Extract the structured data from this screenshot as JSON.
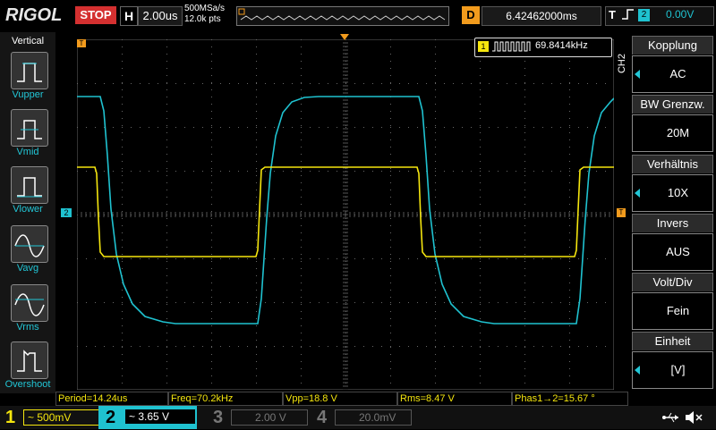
{
  "topbar": {
    "logo": "RIGOL",
    "run_state": "STOP",
    "horizontal_icon": "H",
    "timebase": "2.00us",
    "sample_rate": "500MSa/s",
    "memory_depth": "12.0k pts",
    "delay_icon": "D",
    "delay_value": "6.42462000ms",
    "trigger_icon": "T",
    "trigger_edge_icon": "rising-edge-icon",
    "trigger_source": "2",
    "trigger_level": "0.00V"
  },
  "left_panel": {
    "title": "Vertical",
    "items": [
      {
        "label": "Vupper",
        "icon": "vupper-icon"
      },
      {
        "label": "Vmid",
        "icon": "vmid-icon"
      },
      {
        "label": "Vlower",
        "icon": "vlower-icon"
      },
      {
        "label": "Vavg",
        "icon": "vavg-icon"
      },
      {
        "label": "Vrms",
        "icon": "vrms-icon"
      },
      {
        "label": "Overshoot",
        "icon": "overshoot-icon"
      }
    ]
  },
  "frequency_counter": {
    "channel": "1",
    "value": "69.8414kHz"
  },
  "markers": {
    "ch1_level": "1",
    "ch2_level": "2",
    "trigger_position": "T"
  },
  "right_menu": {
    "channel_label": "CH2",
    "items": [
      {
        "title": "Kopplung",
        "value": "AC"
      },
      {
        "title": "BW Grenzw.",
        "value": "20M"
      },
      {
        "title": "Verhältnis",
        "value": "10X"
      },
      {
        "title": "Invers",
        "value": "AUS"
      },
      {
        "title": "Volt/Div",
        "value": "Fein"
      },
      {
        "title": "Einheit",
        "value": "[V]"
      }
    ]
  },
  "measurements": [
    {
      "text": "Period=14.24us"
    },
    {
      "text": "Freq=70.2kHz"
    },
    {
      "text": "Vpp=18.8 V"
    },
    {
      "text": "Rms=8.47 V"
    },
    {
      "text": "Phas1→2=15.67 °"
    }
  ],
  "channels": [
    {
      "num": "1",
      "coupling": "~",
      "scale": "500mV",
      "active": true,
      "color": "#f5e60e"
    },
    {
      "num": "2",
      "coupling": "~",
      "scale": "3.65 V",
      "active": true,
      "color": "#1fc2d0"
    },
    {
      "num": "3",
      "coupling": "",
      "scale": "2.00 V",
      "active": false,
      "color": "#777777"
    },
    {
      "num": "4",
      "coupling": "",
      "scale": "20.0mV",
      "active": false,
      "color": "#777777"
    }
  ],
  "colors": {
    "ch1": "#f5e60e",
    "ch2": "#1fc2d0",
    "trigger": "#f29b1d",
    "stop": "#d43030"
  },
  "status_icons": [
    "usb-icon",
    "speaker-mute-icon"
  ]
}
